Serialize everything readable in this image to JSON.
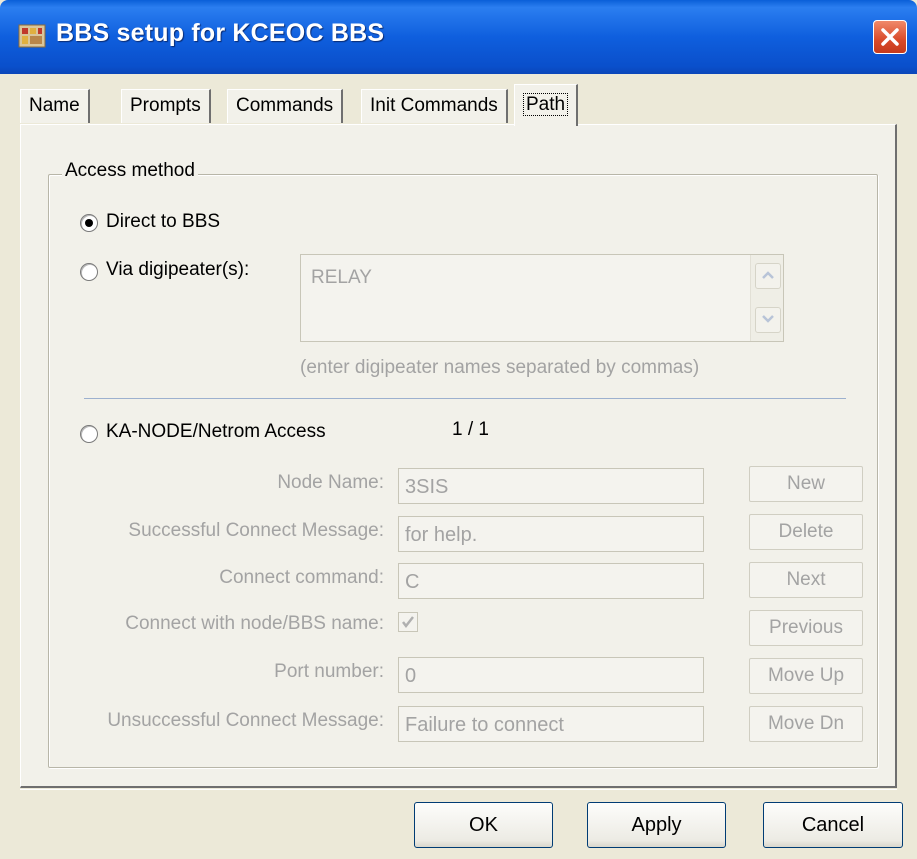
{
  "window": {
    "title": "BBS setup for KCEOC BBS",
    "close_icon": "close-icon"
  },
  "tabs": [
    {
      "label": "Name"
    },
    {
      "label": "Prompts"
    },
    {
      "label": "Commands"
    },
    {
      "label": "Init Commands"
    },
    {
      "label": "Path",
      "active": true
    }
  ],
  "access": {
    "group_label": "Access method",
    "direct_label": "Direct to BBS",
    "direct_selected": true,
    "digi_label": "Via digipeater(s):",
    "digi_value": "RELAY",
    "digi_hint": "(enter digipeater names separated by commas)",
    "node_label": "KA-NODE/Netrom Access",
    "node_counter": "1 / 1"
  },
  "node": {
    "node_name_label": "Node Name:",
    "node_name_value": "3SIS",
    "success_label": "Successful Connect Message:",
    "success_value": "for help.",
    "connect_cmd_label": "Connect command:",
    "connect_cmd_value": "C",
    "connect_with_label": "Connect with node/BBS name:",
    "connect_with_checked": true,
    "port_label": "Port number:",
    "port_value": "0",
    "unsuccess_label": "Unsuccessful Connect Message:",
    "unsuccess_value": "Failure to connect"
  },
  "side_buttons": {
    "new": "New",
    "delete": "Delete",
    "next": "Next",
    "previous": "Previous",
    "move_up": "Move Up",
    "move_dn": "Move Dn"
  },
  "dialog_buttons": {
    "ok": "OK",
    "apply": "Apply",
    "cancel": "Cancel"
  },
  "colors": {
    "titlebar": "#0a5fd8",
    "window_bg": "#ece9d8",
    "disabled_text": "#a3a3a3",
    "close": "#d94a2a"
  }
}
